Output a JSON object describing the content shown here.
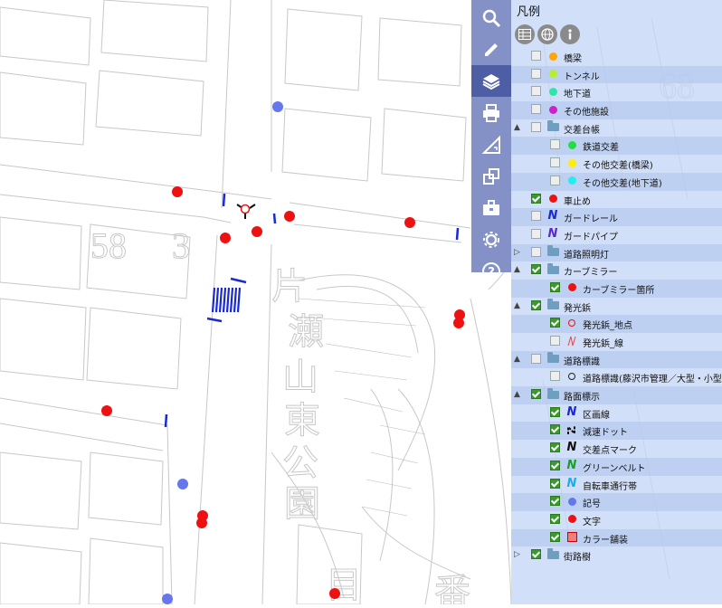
{
  "legend": {
    "title": "凡例",
    "buttons": [
      {
        "icon": "table-icon"
      },
      {
        "icon": "globe-icon"
      },
      {
        "icon": "info-icon"
      }
    ],
    "rows": [
      {
        "level": 1,
        "expand": "",
        "checked": false,
        "icon": "dot",
        "color": "#ffa500",
        "label": "橋梁"
      },
      {
        "level": 1,
        "expand": "",
        "checked": false,
        "icon": "dot",
        "color": "#b8ee2a",
        "label": "トンネル"
      },
      {
        "level": 1,
        "expand": "",
        "checked": false,
        "icon": "dot",
        "color": "#2ee6a8",
        "label": "地下道"
      },
      {
        "level": 1,
        "expand": "",
        "checked": false,
        "icon": "dot",
        "color": "#cc22cc",
        "label": "その他施設"
      },
      {
        "level": 0,
        "expand": "▲",
        "checked": false,
        "icon": "folder",
        "color": "#6e9fc0",
        "label": "交差台帳"
      },
      {
        "level": 2,
        "expand": "",
        "checked": false,
        "icon": "dot",
        "color": "#22dd44",
        "label": "鉄道交差"
      },
      {
        "level": 2,
        "expand": "",
        "checked": false,
        "icon": "dot",
        "color": "#ffee00",
        "label": "その他交差(橋梁)"
      },
      {
        "level": 2,
        "expand": "",
        "checked": false,
        "icon": "dot",
        "color": "#22eeee",
        "label": "その他交差(地下道)"
      },
      {
        "level": 1,
        "expand": "",
        "checked": true,
        "icon": "dot",
        "color": "#ee1111",
        "label": "車止め"
      },
      {
        "level": 1,
        "expand": "",
        "checked": false,
        "icon": "nglyph",
        "color": "#1a2ad0",
        "label": "ガードレール"
      },
      {
        "level": 1,
        "expand": "",
        "checked": false,
        "icon": "nglyph",
        "color": "#5a2ad0",
        "label": "ガードパイプ"
      },
      {
        "level": 0,
        "expand": "▷",
        "checked": false,
        "icon": "folder",
        "color": "#6e9fc0",
        "label": "道路照明灯"
      },
      {
        "level": 0,
        "expand": "▲",
        "checked": true,
        "icon": "folder",
        "color": "#6e9fc0",
        "label": "カーブミラー"
      },
      {
        "level": 2,
        "expand": "",
        "checked": true,
        "icon": "dot",
        "color": "#ee1111",
        "label": "カーブミラー箇所"
      },
      {
        "level": 0,
        "expand": "▲",
        "checked": true,
        "icon": "folder",
        "color": "#6e9fc0",
        "label": "発光鋲"
      },
      {
        "level": 2,
        "expand": "",
        "checked": true,
        "icon": "ring",
        "color": "#ee1111",
        "label": "発光鋲_地点"
      },
      {
        "level": 2,
        "expand": "",
        "checked": false,
        "icon": "slash",
        "color": "#ee4444",
        "label": "発光鋲_線"
      },
      {
        "level": 0,
        "expand": "▲",
        "checked": false,
        "icon": "folder",
        "color": "#6e9fc0",
        "label": "道路標識"
      },
      {
        "level": 2,
        "expand": "",
        "checked": false,
        "icon": "ring",
        "color": "#222222",
        "label": "道路標識(藤沢市管理／大型・小型"
      },
      {
        "level": 0,
        "expand": "▲",
        "checked": true,
        "icon": "folder",
        "color": "#6e9fc0",
        "label": "路面標示"
      },
      {
        "level": 2,
        "expand": "",
        "checked": true,
        "icon": "nglyph",
        "color": "#1a2ad0",
        "label": "区画線"
      },
      {
        "level": 2,
        "expand": "",
        "checked": true,
        "icon": "dashn",
        "color": "#111111",
        "label": "減速ドット"
      },
      {
        "level": 2,
        "expand": "",
        "checked": true,
        "icon": "nglyph",
        "color": "#111111",
        "label": "交差点マーク"
      },
      {
        "level": 2,
        "expand": "",
        "checked": true,
        "icon": "nglyph",
        "color": "#1aa02a",
        "label": "グリーンベルト"
      },
      {
        "level": 2,
        "expand": "",
        "checked": true,
        "icon": "nglyph",
        "color": "#22aaee",
        "label": "自転車通行帯"
      },
      {
        "level": 2,
        "expand": "",
        "checked": true,
        "icon": "dot",
        "color": "#6677ee",
        "label": "記号"
      },
      {
        "level": 2,
        "expand": "",
        "checked": true,
        "icon": "dot",
        "color": "#ee1111",
        "label": "文字"
      },
      {
        "level": 2,
        "expand": "",
        "checked": true,
        "icon": "square",
        "color": "#f08080",
        "label": "カラー舗装"
      },
      {
        "level": 0,
        "expand": "▷",
        "checked": true,
        "icon": "folder",
        "color": "#6e9fc0",
        "label": "街路樹"
      }
    ]
  },
  "toolbar": {
    "tools": [
      {
        "icon": "search-icon",
        "active": false
      },
      {
        "icon": "pencil-icon",
        "active": false
      },
      {
        "icon": "layers-icon",
        "active": true
      },
      {
        "icon": "print-icon",
        "active": false
      },
      {
        "icon": "measure-icon",
        "active": false
      },
      {
        "icon": "windows-icon",
        "active": false
      },
      {
        "icon": "toolbox-icon",
        "active": false
      },
      {
        "icon": "gear-icon",
        "active": false
      },
      {
        "icon": "help-icon",
        "active": false
      }
    ]
  },
  "map": {
    "labels": [
      {
        "text": "58"
      },
      {
        "text": "3"
      },
      {
        "text": "片"
      },
      {
        "text": "瀬"
      },
      {
        "text": "山"
      },
      {
        "text": "東"
      },
      {
        "text": "公"
      },
      {
        "text": "園"
      },
      {
        "text": "68"
      },
      {
        "text": "目"
      },
      {
        "text": "番"
      }
    ],
    "colors": {
      "curve_mirror": "#ee1111",
      "symbol": "#6677ee",
      "lane_line": "#1a2ad0",
      "outline": "#bdbdbd"
    }
  }
}
